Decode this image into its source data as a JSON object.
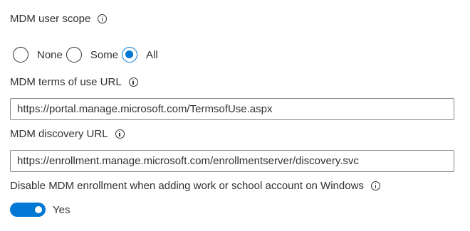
{
  "scope": {
    "label": "MDM user scope",
    "options": [
      {
        "label": "None",
        "checked": false
      },
      {
        "label": "Some",
        "checked": false
      },
      {
        "label": "All",
        "checked": true
      }
    ]
  },
  "terms_url": {
    "label": "MDM terms of use URL",
    "value": "https://portal.manage.microsoft.com/TermsofUse.aspx"
  },
  "discovery_url": {
    "label": "MDM discovery URL",
    "value": "https://enrollment.manage.microsoft.com/enrollmentserver/discovery.svc"
  },
  "disable_enrollment": {
    "label": "Disable MDM enrollment when adding work or school account on Windows",
    "toggle_state": "Yes",
    "on": true
  },
  "colors": {
    "accent": "#0078d4",
    "text": "#323130",
    "border": "#8a8886"
  },
  "icons": {
    "info": "info-icon"
  }
}
